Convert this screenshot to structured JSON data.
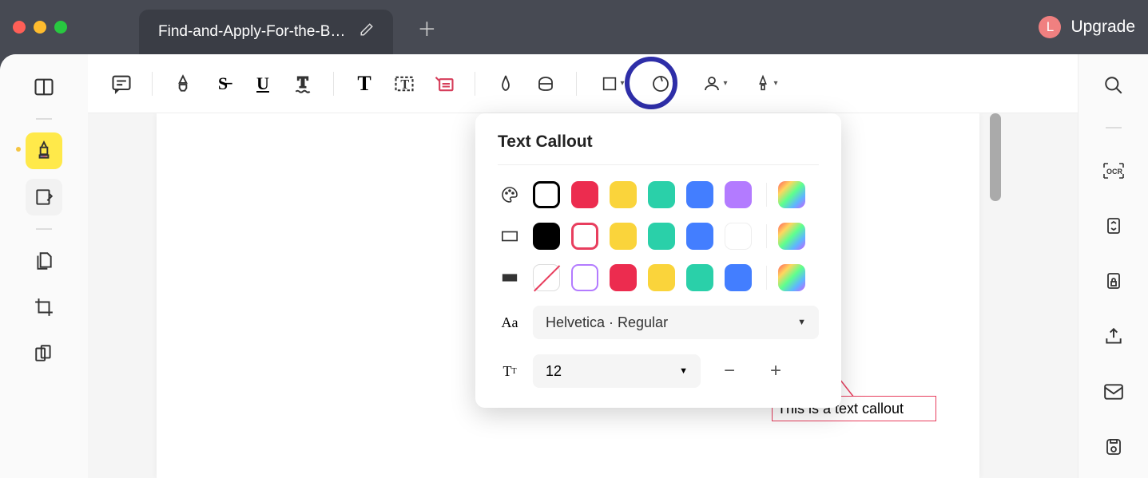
{
  "titlebar": {
    "tab_title": "Find-and-Apply-For-the-B…",
    "upgrade_label": "Upgrade",
    "user_initial": "L"
  },
  "panel": {
    "title": "Text Callout",
    "font_label": "Helvetica · Regular",
    "font_size": "12",
    "colors_fill": [
      "#000000",
      "#ec2c4f",
      "#fad43b",
      "#2ad0a9",
      "#437eff",
      "#b37bff"
    ],
    "colors_text": [
      "#000000",
      "#ec2c4f",
      "#fad43b",
      "#2ad0a9",
      "#437eff",
      "#ffffff"
    ],
    "colors_border": [
      "none",
      "#b37bff",
      "#ec2c4f",
      "#fad43b",
      "#2ad0a9",
      "#437eff"
    ]
  },
  "callout": {
    "text": "This is a text callout"
  }
}
